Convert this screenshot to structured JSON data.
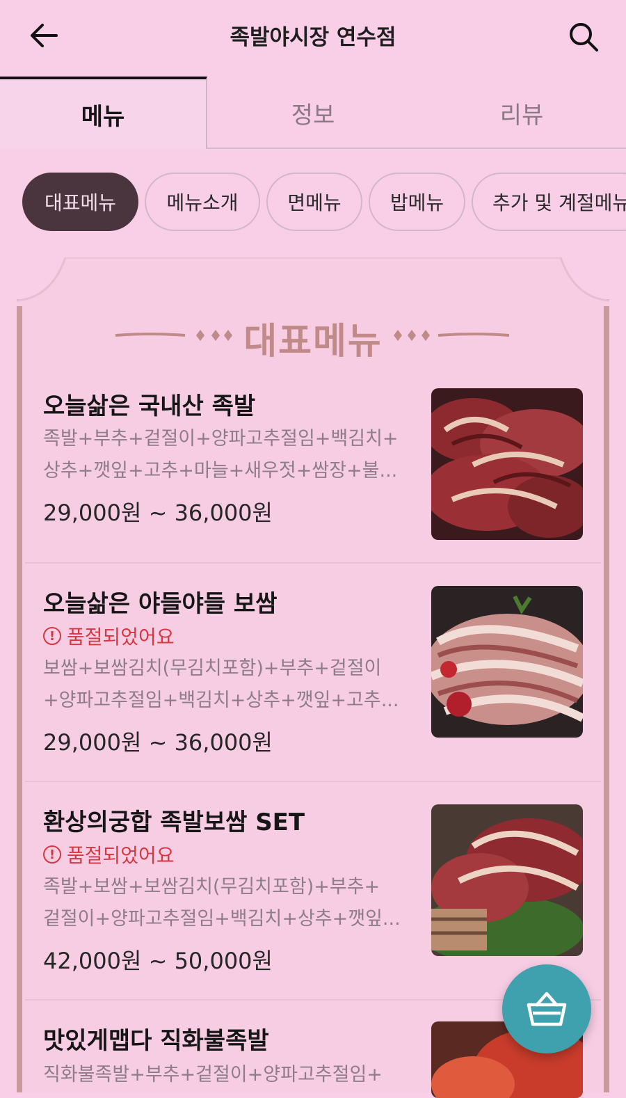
{
  "header": {
    "title": "족발야시장 연수점"
  },
  "tabs": [
    {
      "label": "메뉴",
      "active": true
    },
    {
      "label": "정보",
      "active": false
    },
    {
      "label": "리뷰",
      "active": false
    }
  ],
  "chips": [
    {
      "label": "대표메뉴",
      "active": true
    },
    {
      "label": "메뉴소개",
      "active": false
    },
    {
      "label": "면메뉴",
      "active": false
    },
    {
      "label": "밥메뉴",
      "active": false
    },
    {
      "label": "추가 및 계절메뉴",
      "active": false
    }
  ],
  "section": {
    "title": "대표메뉴"
  },
  "items": [
    {
      "name": "오늘삶은 국내산 족발",
      "desc_line1": "족발+부추+겉절이+양파고추절임+백김치+",
      "desc_line2": "상추+깻잎+고추+마늘+새우젓+쌈장+불...",
      "price": "29,000원 ~ 36,000원"
    },
    {
      "name": "오늘삶은 야들야들 보쌈",
      "soldout": "품절되었어요",
      "desc_line1": "보쌈+보쌈김치(무김치포함)+부추+겉절이",
      "desc_line2": "+양파고추절임+백김치+상추+깻잎+고추...",
      "price": "29,000원 ~ 36,000원"
    },
    {
      "name": "환상의궁합 족발보쌈 SET",
      "soldout": "품절되었어요",
      "desc_line1": "족발+보쌈+보쌈김치(무김치포함)+부추+",
      "desc_line2": "겉절이+양파고추절임+백김치+상추+깻잎...",
      "price": "42,000원 ~ 50,000원"
    },
    {
      "name": "맛있게맵다 직화불족발",
      "desc_line1": "직화불족발+부추+겉절이+양파고추절임+"
    }
  ],
  "colors": {
    "background": "#f9cfe8",
    "accent": "#4a343e",
    "soldout": "#d7373f",
    "cart": "#3fa1ad",
    "panel_border": "#c89a9c"
  }
}
